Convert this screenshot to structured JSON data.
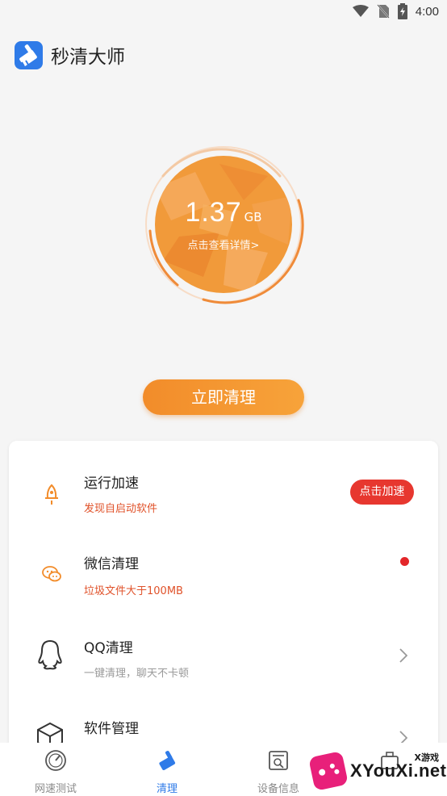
{
  "status_bar": {
    "time": "4:00"
  },
  "app": {
    "title": "秒清大师"
  },
  "storage": {
    "value": "1.37",
    "unit": "GB",
    "detail_link": "点击查看详情>"
  },
  "clean_button": {
    "label": "立即清理"
  },
  "items": [
    {
      "title": "运行加速",
      "subtitle": "发现自启动软件",
      "action": "点击加速",
      "icon": "rocket-icon"
    },
    {
      "title": "微信清理",
      "subtitle": "垃圾文件大于100MB",
      "icon": "wechat-icon"
    },
    {
      "title": "QQ清理",
      "subtitle": "一键清理，聊天不卡顿",
      "icon": "qq-icon"
    },
    {
      "title": "软件管理",
      "icon": "package-box-icon"
    }
  ],
  "tabs": [
    {
      "label": "网速测试",
      "icon": "speedometer-icon"
    },
    {
      "label": "清理",
      "icon": "broom-icon",
      "active": true
    },
    {
      "label": "设备信息",
      "icon": "device-info-icon"
    },
    {
      "label": "",
      "icon": "toolbox-icon"
    }
  ],
  "watermark": {
    "text": "XYouXi.net",
    "small": "X游戏"
  },
  "colors": {
    "accent_orange": "#f28c2a",
    "brand_blue": "#2f7be8",
    "alert_red": "#e7372f"
  }
}
